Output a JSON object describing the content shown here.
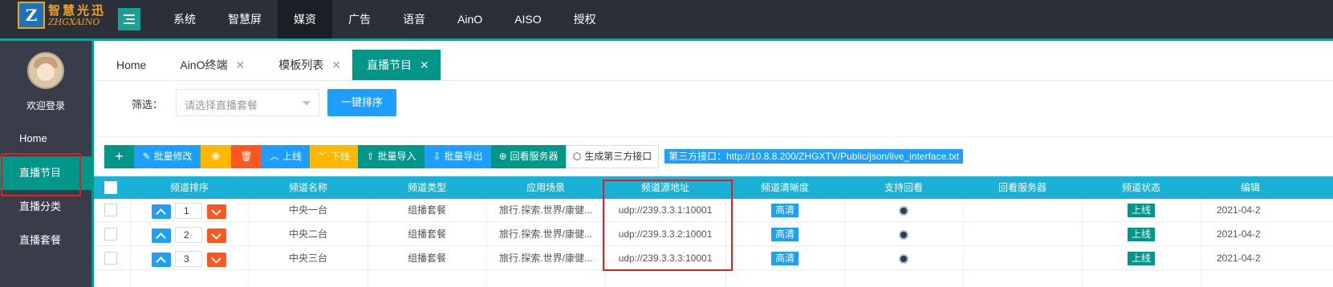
{
  "app": {
    "logo_cn": "智慧光迅",
    "logo_en": "ZHGXAINO",
    "logo_mark": "Z"
  },
  "nav": [
    "系统",
    "智慧屏",
    "媒资",
    "广告",
    "语音",
    "AinO",
    "AISO",
    "授权"
  ],
  "nav_active_index": 2,
  "sidebar": {
    "welcome": "欢迎登录",
    "items": [
      {
        "label": "Home"
      },
      {
        "label": "直播节目",
        "active": true
      },
      {
        "label": "直播分类"
      },
      {
        "label": "直播套餐"
      }
    ]
  },
  "tabs": [
    {
      "label": "Home",
      "closable": false
    },
    {
      "label": "AinO终端",
      "closable": true
    },
    {
      "label": "模板列表",
      "closable": true
    },
    {
      "label": "直播节目",
      "closable": true,
      "active": true
    }
  ],
  "filter": {
    "label": "筛选：",
    "placeholder": "请选择直播套餐",
    "sort_button": "一键排序"
  },
  "toolbar": {
    "add": "+",
    "batch_edit": "批量修改",
    "online": "上线",
    "offline": "下线",
    "batch_import": "批量导入",
    "batch_export": "批量导出",
    "playback_server": "回看服务器",
    "gen_third_party": "生成第三方接口",
    "api_label": "第三方接口：http://10.8.8.200/ZHGXTV/Public/json/live_interface.txt"
  },
  "table": {
    "headers": [
      "频道排序",
      "频道名称",
      "频道类型",
      "应用场景",
      "频道源地址",
      "频道清晰度",
      "支持回看",
      "回看服务器",
      "频道状态",
      "编辑"
    ],
    "rows": [
      {
        "order": "1",
        "name": "中央一台",
        "type": "组播套餐",
        "scene": "旅行.探索.世界/康健...",
        "source": "udp://239.3.3.1:10001",
        "quality": "高清",
        "status": "上线",
        "edit": "2021-04-2"
      },
      {
        "order": "2",
        "name": "中央二台",
        "type": "组播套餐",
        "scene": "旅行.探索.世界/康健...",
        "source": "udp://239.3.3.2:10001",
        "quality": "高清",
        "status": "上线",
        "edit": "2021-04-2"
      },
      {
        "order": "3",
        "name": "中央三台",
        "type": "组播套餐",
        "scene": "旅行.探索.世界/康健...",
        "source": "udp://239.3.3.3:10001",
        "quality": "高清",
        "status": "上线",
        "edit": "2021-04-2"
      }
    ]
  },
  "colors": {
    "topbar": "#2a2f38",
    "accent": "#009688",
    "blue": "#1e9fff",
    "table_header": "#1ab0d8",
    "highlight_red": "#e02020"
  }
}
